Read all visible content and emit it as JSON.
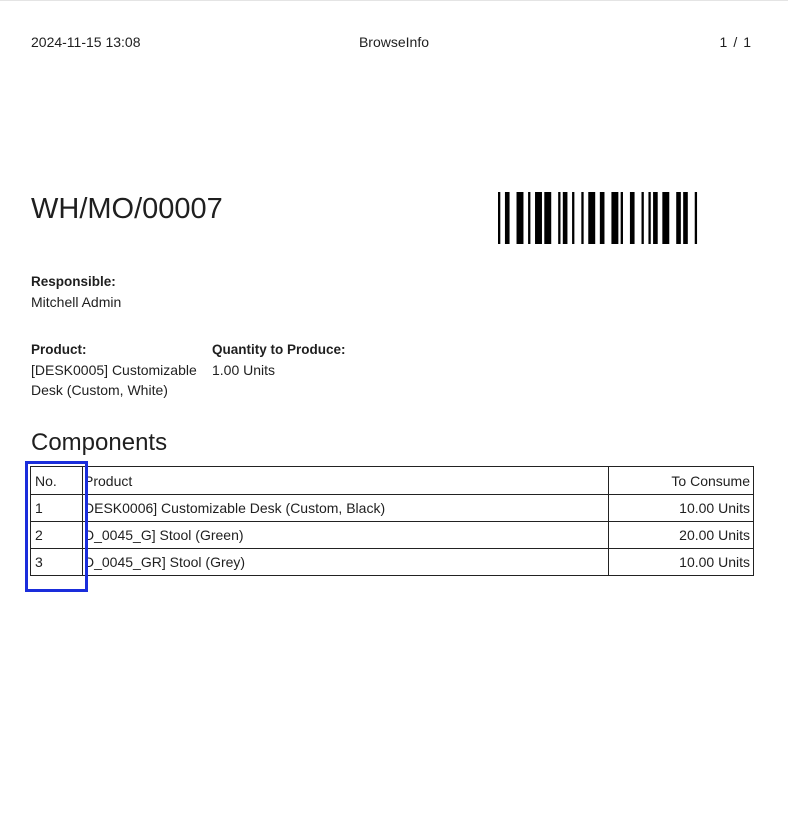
{
  "header": {
    "datetime": "2024-11-15 13:08",
    "company": "BrowseInfo",
    "page_current": "1",
    "page_separator": "/",
    "page_total": "1"
  },
  "document": {
    "reference": "WH/MO/00007",
    "barcode_value": "WH/MO/00007"
  },
  "responsible": {
    "label": "Responsible:",
    "value": "Mitchell Admin"
  },
  "product": {
    "label": "Product:",
    "value_line1": "[DESK0005] Customizable",
    "value_line2": "Desk (Custom, White)"
  },
  "quantity": {
    "label": "Quantity to Produce:",
    "value": "1.00 Units"
  },
  "components": {
    "title": "Components",
    "columns": [
      "No.",
      "Product",
      "To Consume"
    ],
    "rows": [
      {
        "no": "1",
        "product": "DESK0006] Customizable Desk (Custom, Black)",
        "to_consume": "10.00 Units"
      },
      {
        "no": "2",
        "product": "D_0045_G] Stool (Green)",
        "to_consume": "20.00 Units"
      },
      {
        "no": "3",
        "product": "D_0045_GR] Stool (Grey)",
        "to_consume": "10.00 Units"
      }
    ]
  },
  "colors": {
    "highlight": "#1a2ddb",
    "text": "#1f1f1f",
    "border": "#222222"
  }
}
